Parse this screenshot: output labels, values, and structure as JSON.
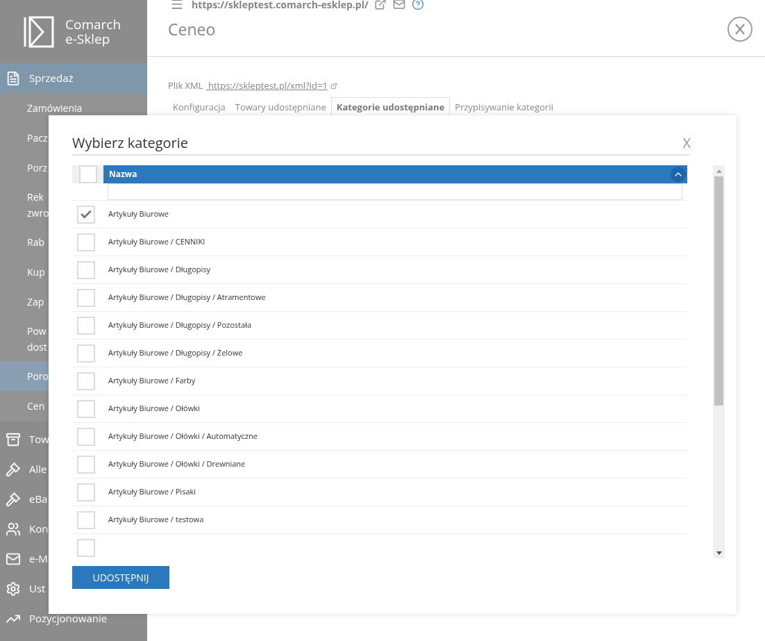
{
  "sidebar": {
    "logo": {
      "line1": "Comarch",
      "line2": "e-Sklep"
    },
    "items": [
      {
        "kind": "section",
        "label": "Sprzedaż",
        "selected": true
      },
      {
        "kind": "sub",
        "label": "Zamówienia",
        "selected": false
      },
      {
        "kind": "sub",
        "label": "Pacz",
        "selected": false
      },
      {
        "kind": "sub",
        "label": "Porz",
        "selected": false
      },
      {
        "kind": "sub",
        "label": "Rek\nzwro",
        "selected": false
      },
      {
        "kind": "sub",
        "label": "Rab",
        "selected": false
      },
      {
        "kind": "sub",
        "label": "Kup",
        "selected": false
      },
      {
        "kind": "sub",
        "label": "Zap",
        "selected": false
      },
      {
        "kind": "sub",
        "label": "Pow\ndost",
        "selected": false
      },
      {
        "kind": "sub",
        "label": "Poro",
        "selected": true
      },
      {
        "kind": "sub",
        "label": "Cen",
        "selected": false
      },
      {
        "kind": "section",
        "label": "Tow",
        "selected": false
      },
      {
        "kind": "section",
        "label": "Alle",
        "selected": false
      },
      {
        "kind": "section",
        "label": "eBa",
        "selected": false
      },
      {
        "kind": "section",
        "label": "Kon",
        "selected": false
      },
      {
        "kind": "section",
        "label": "e-M",
        "selected": false
      },
      {
        "kind": "section",
        "label": "Ust",
        "selected": false
      },
      {
        "kind": "section",
        "label": "Pozycjonowanie",
        "selected": false
      }
    ]
  },
  "header": {
    "url": "https://skleptest.comarch-esklep.pl/",
    "title": "Ceneo"
  },
  "xml_file": {
    "label": "Plik XML",
    "link": " https://skleptest.pl/xml?id=1"
  },
  "tabs": [
    {
      "label": "Konfiguracja",
      "selected": false
    },
    {
      "label": "Towary udostępniane",
      "selected": false
    },
    {
      "label": "Kategorie udostępniane",
      "selected": true
    },
    {
      "label": "Przypisywanie kategorii",
      "selected": false
    }
  ],
  "dialog": {
    "title": "Wybierz kategorie",
    "close": "X",
    "select_all": {
      "checked": false
    },
    "column": "Nazwa",
    "rows": [
      {
        "label": "Artykuły Biurowe",
        "checked": true
      },
      {
        "label": "Artykuły Biurowe / CENNIKI",
        "checked": false
      },
      {
        "label": "Artykuły Biurowe / Długopisy",
        "checked": false
      },
      {
        "label": "Artykuły Biurowe / Długopisy / Atramentowe",
        "checked": false
      },
      {
        "label": "Artykuły Biurowe / Długopisy / Pozostała",
        "checked": false
      },
      {
        "label": "Artykuły Biurowe / Długopisy / Żelowe",
        "checked": false
      },
      {
        "label": "Artykuły Biurowe / Farby",
        "checked": false
      },
      {
        "label": "Artykuły Biurowe / Ołówki",
        "checked": false
      },
      {
        "label": "Artykuły Biurowe / Ołówki / Automatyczne",
        "checked": false
      },
      {
        "label": "Artykuły Biurowe / Ołówki / Drewniane",
        "checked": false
      },
      {
        "label": "Artykuły Biurowe / Pisaki",
        "checked": false
      },
      {
        "label": "Artykuły Biurowe / testowa",
        "checked": false
      },
      {
        "checked": false
      }
    ],
    "button": "UDOSTĘPNIJ"
  }
}
